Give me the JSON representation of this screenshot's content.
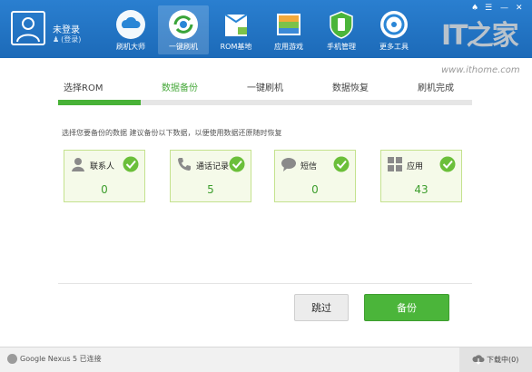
{
  "header": {
    "user": {
      "name": "未登录",
      "login_link": "(登录)"
    },
    "nav": [
      {
        "label": "刷机大师",
        "icon": "cloud-icon",
        "active": false
      },
      {
        "label": "一键刷机",
        "icon": "refresh-flash-icon",
        "active": true
      },
      {
        "label": "ROM基地",
        "icon": "rom-box-icon",
        "active": false
      },
      {
        "label": "应用游戏",
        "icon": "apps-icon",
        "active": false
      },
      {
        "label": "手机管理",
        "icon": "phone-shield-icon",
        "active": false
      },
      {
        "label": "更多工具",
        "icon": "tools-icon",
        "active": false
      }
    ],
    "window_controls": [
      "shirt-icon",
      "menu-icon",
      "minimize-icon",
      "close-icon"
    ]
  },
  "watermark": {
    "logo": "IT之家",
    "url": "www.ithome.com"
  },
  "steps": {
    "items": [
      "选择ROM",
      "数据备份",
      "一键刷机",
      "数据恢复",
      "刷机完成"
    ],
    "active_index": 1,
    "progress_fraction": 0.2
  },
  "description": "选择您要备份的数据 建议备份以下数据，以便使用数据还原随时恢复",
  "cards": [
    {
      "label": "联系人",
      "count": "0",
      "icon": "person-icon",
      "checked": true
    },
    {
      "label": "通话记录",
      "count": "5",
      "icon": "phone-icon",
      "checked": true
    },
    {
      "label": "短信",
      "count": "0",
      "icon": "message-icon",
      "checked": true
    },
    {
      "label": "应用",
      "count": "43",
      "icon": "grid-apps-icon",
      "checked": true
    }
  ],
  "buttons": {
    "skip": "跳过",
    "backup": "备份"
  },
  "statusbar": {
    "device": "Google Nexus 5 已连接",
    "download": "下载中(0)"
  },
  "colors": {
    "header": "#1f72c2",
    "accent_green": "#4bb53a",
    "card_bg": "#f5fae9",
    "card_border": "#c4e28e"
  }
}
